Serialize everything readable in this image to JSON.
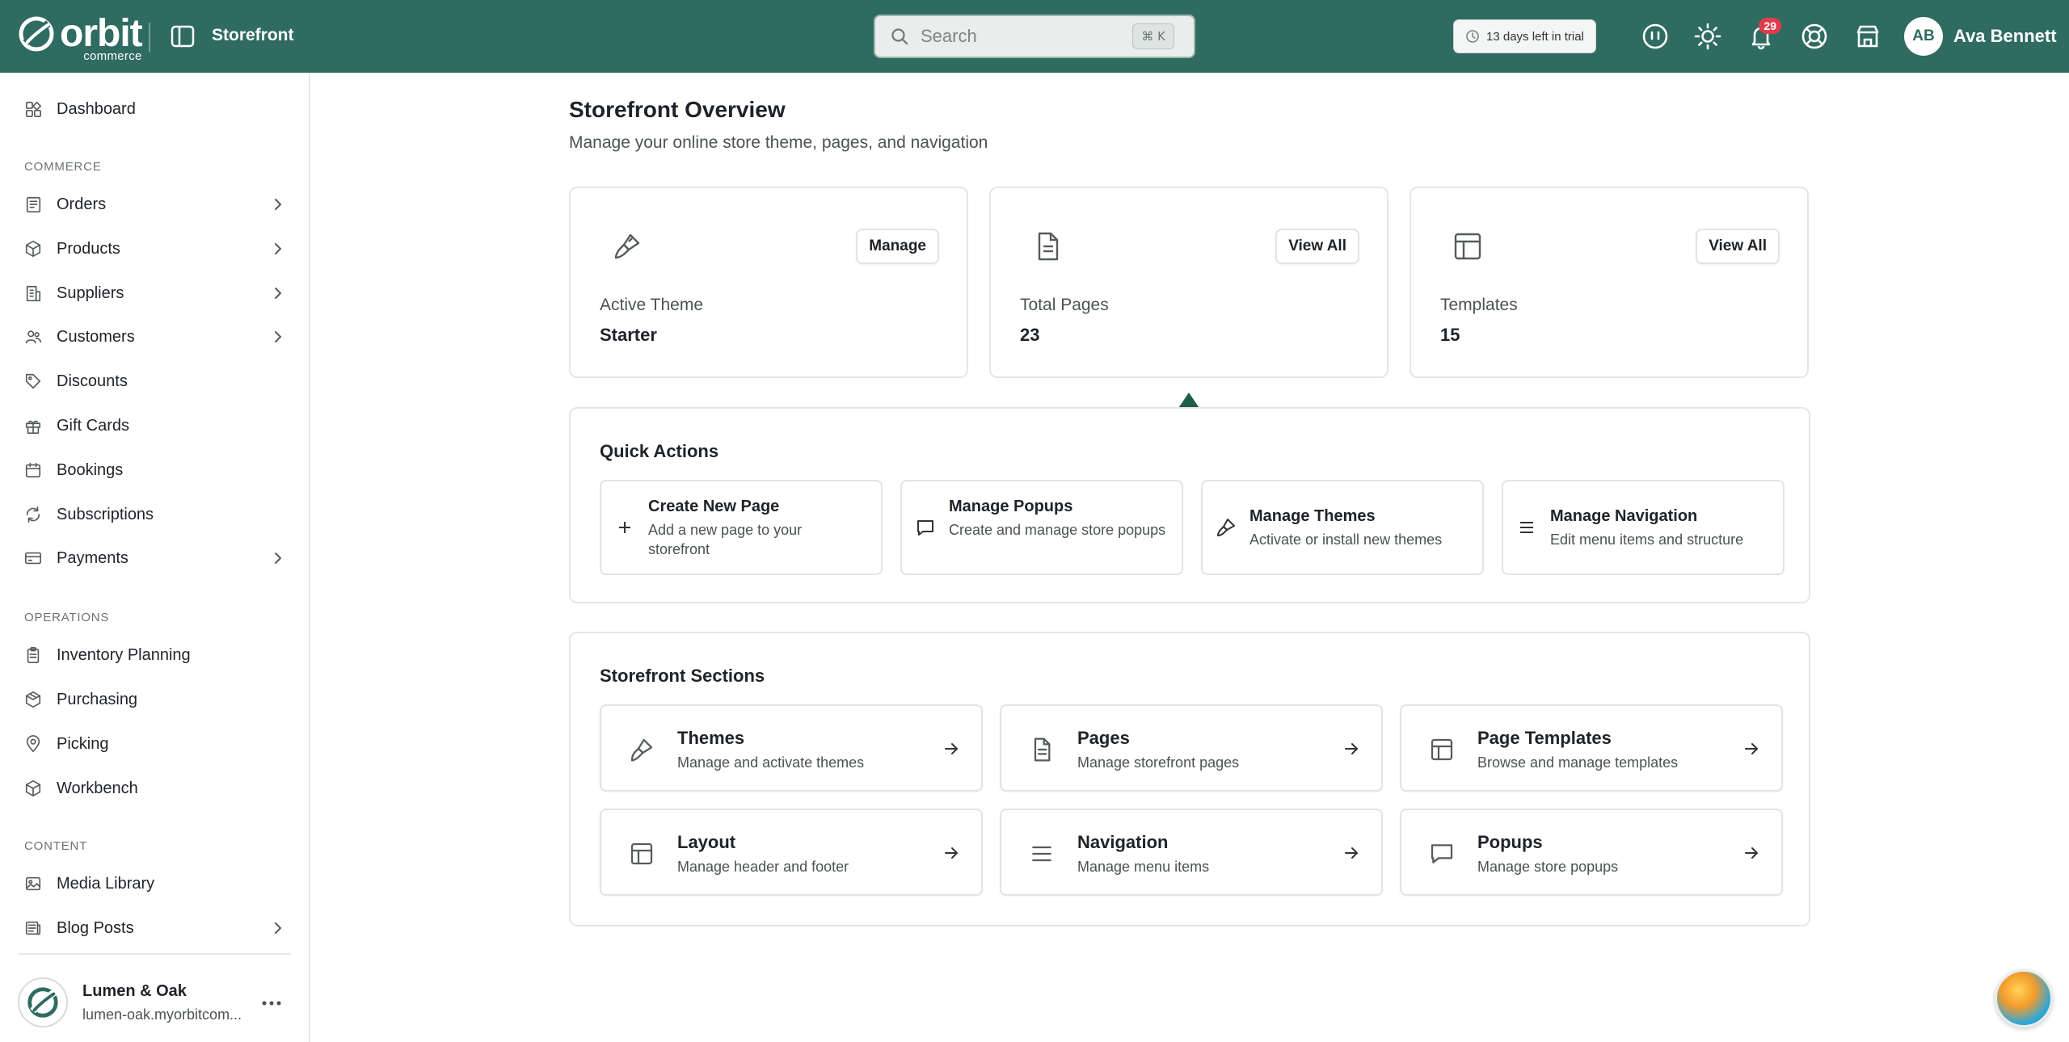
{
  "header": {
    "logo_word": "orbit",
    "logo_sub": "commerce",
    "app_title": "Storefront",
    "search_placeholder": "Search",
    "search_shortcut": "⌘ K",
    "trial_text": "13 days left in trial",
    "notification_count": "29",
    "user_initials": "AB",
    "user_name": "Ava Bennett"
  },
  "sidebar": {
    "top_items": [
      {
        "label": "Dashboard",
        "icon": "dashboard-icon"
      }
    ],
    "sections": [
      {
        "label": "COMMERCE",
        "items": [
          {
            "label": "Orders",
            "icon": "orders-icon",
            "chevron": true
          },
          {
            "label": "Products",
            "icon": "box-icon",
            "chevron": true
          },
          {
            "label": "Suppliers",
            "icon": "building-icon",
            "chevron": true
          },
          {
            "label": "Customers",
            "icon": "users-icon",
            "chevron": true
          },
          {
            "label": "Discounts",
            "icon": "tag-icon",
            "chevron": false
          },
          {
            "label": "Gift Cards",
            "icon": "gift-icon",
            "chevron": false
          },
          {
            "label": "Bookings",
            "icon": "calendar-icon",
            "chevron": false
          },
          {
            "label": "Subscriptions",
            "icon": "refresh-icon",
            "chevron": false
          },
          {
            "label": "Payments",
            "icon": "card-icon",
            "chevron": true
          }
        ]
      },
      {
        "label": "OPERATIONS",
        "items": [
          {
            "label": "Inventory Planning",
            "icon": "clipboard-icon",
            "chevron": false
          },
          {
            "label": "Purchasing",
            "icon": "package-icon",
            "chevron": false
          },
          {
            "label": "Picking",
            "icon": "map-pin-icon",
            "chevron": false
          },
          {
            "label": "Workbench",
            "icon": "cube-icon",
            "chevron": false
          }
        ]
      },
      {
        "label": "CONTENT",
        "items": [
          {
            "label": "Media Library",
            "icon": "image-icon",
            "chevron": false
          },
          {
            "label": "Blog Posts",
            "icon": "newspaper-icon",
            "chevron": true
          }
        ]
      }
    ],
    "store": {
      "name": "Lumen & Oak",
      "url": "lumen-oak.myorbitcom..."
    }
  },
  "main": {
    "title": "Storefront Overview",
    "subtitle": "Manage your online store theme, pages, and navigation",
    "stats": [
      {
        "label": "Active Theme",
        "value": "Starter",
        "button": "Manage",
        "icon": "brush-icon"
      },
      {
        "label": "Total Pages",
        "value": "23",
        "button": "View All",
        "icon": "file-icon"
      },
      {
        "label": "Templates",
        "value": "15",
        "button": "View All",
        "icon": "layout-icon"
      }
    ],
    "quick_actions": {
      "title": "Quick Actions",
      "items": [
        {
          "title": "Create New Page",
          "desc": "Add a new page to your storefront",
          "icon": "plus-icon"
        },
        {
          "title": "Manage Popups",
          "desc": "Create and manage store popups",
          "icon": "message-square-icon"
        },
        {
          "title": "Manage Themes",
          "desc": "Activate or install new themes",
          "icon": "brush-icon"
        },
        {
          "title": "Manage Navigation",
          "desc": "Edit menu items and structure",
          "icon": "menu-icon"
        }
      ]
    },
    "sections": {
      "title": "Storefront Sections",
      "items": [
        {
          "title": "Themes",
          "desc": "Manage and activate themes",
          "icon": "brush-icon"
        },
        {
          "title": "Pages",
          "desc": "Manage storefront pages",
          "icon": "file-icon"
        },
        {
          "title": "Page Templates",
          "desc": "Browse and manage templates",
          "icon": "layout-icon"
        },
        {
          "title": "Layout",
          "desc": "Manage header and footer",
          "icon": "layout-icon"
        },
        {
          "title": "Navigation",
          "desc": "Manage menu items",
          "icon": "menu-icon"
        },
        {
          "title": "Popups",
          "desc": "Manage store popups",
          "icon": "message-square-icon"
        }
      ]
    }
  },
  "colors": {
    "header_bg": "#2f6b61",
    "badge": "#e23b4c",
    "arrow": "#1e5e46"
  }
}
